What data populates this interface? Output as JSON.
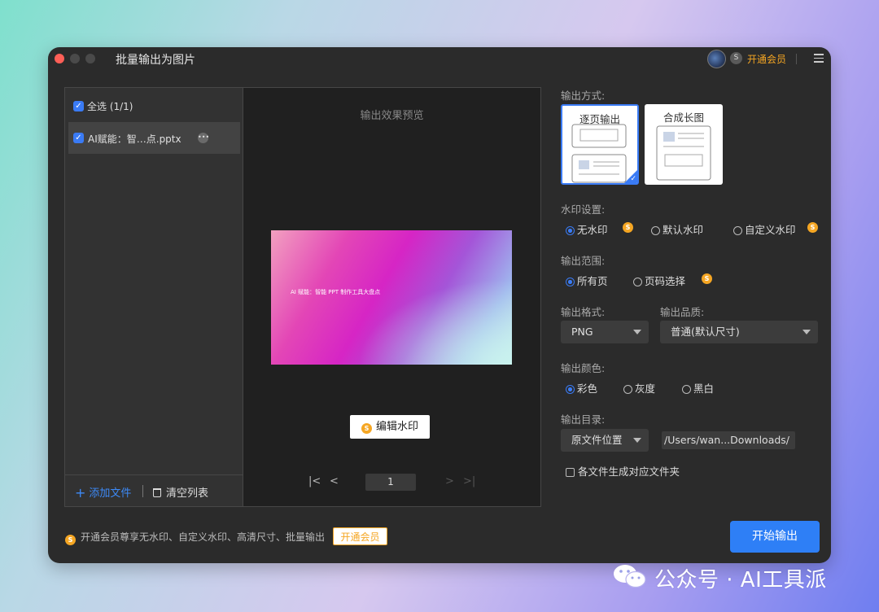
{
  "window": {
    "title": "批量输出为图片",
    "vip_link": "开通会员",
    "vip_badge": "S"
  },
  "file_list": {
    "select_all": "全选 (1/1)",
    "files": [
      {
        "name": "AI赋能：智…点.pptx",
        "checked": true
      }
    ],
    "add_file": "添加文件",
    "clear_list": "清空列表"
  },
  "preview": {
    "title": "输出效果预览",
    "slide_text": "AI 赋能：智能 PPT 制作工具大盘点",
    "edit_watermark": "编辑水印",
    "page_number": "1"
  },
  "settings": {
    "output_mode": {
      "label": "输出方式:",
      "options": [
        "逐页输出",
        "合成长图"
      ],
      "selected": "逐页输出"
    },
    "watermark": {
      "label": "水印设置:",
      "options": [
        "无水印",
        "默认水印",
        "自定义水印"
      ],
      "selected": "无水印"
    },
    "range": {
      "label": "输出范围:",
      "options": [
        "所有页",
        "页码选择"
      ],
      "selected": "所有页"
    },
    "format": {
      "label": "输出格式:",
      "value": "PNG"
    },
    "quality": {
      "label": "输出品质:",
      "value": "普通(默认尺寸)"
    },
    "color": {
      "label": "输出颜色:",
      "options": [
        "彩色",
        "灰度",
        "黑白"
      ],
      "selected": "彩色"
    },
    "directory": {
      "label": "输出目录:",
      "location": "原文件位置",
      "path": "/Users/wan...Downloads/"
    },
    "per_file_folder": {
      "label": "各文件生成对应文件夹",
      "checked": false
    }
  },
  "footer": {
    "promo_text": "开通会员尊享无水印、自定义水印、高清尺寸、批量输出",
    "vip_button": "开通会员",
    "start_button": "开始输出"
  },
  "overlay_watermark": "公众号 · AI工具派",
  "colors": {
    "accent": "#2e7ff6",
    "vip": "#f5a623",
    "window_bg": "#2b2b2b"
  }
}
